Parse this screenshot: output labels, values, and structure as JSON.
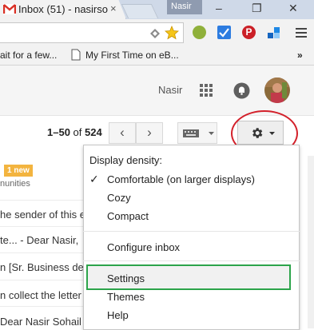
{
  "browser": {
    "tab_title": "Inbox (51) - nasirso",
    "tab_close": "×",
    "user_chip": "Nasir",
    "window_controls": [
      "–",
      "❐",
      "✕"
    ],
    "extensions": [
      "diamond-icon",
      "star-icon",
      "puzzle-icon",
      "check-icon",
      "pinterest-icon",
      "dropbox-icon",
      "menu-icon"
    ],
    "bookmarks": [
      {
        "label": "ait for a few..."
      },
      {
        "label": "My First Time on eB..."
      }
    ],
    "bookmarks_overflow": "»"
  },
  "gmail": {
    "user_name": "Nasir",
    "pager": {
      "range": "1–50",
      "of_label": "of",
      "total": "524"
    },
    "prev_icon": "‹",
    "next_icon": "›",
    "list_rows": [
      {
        "text": "nunities"
      },
      {
        "text": "he sender of this e"
      },
      {
        "text": "te... - Dear Nasir, "
      },
      {
        "text": "n [Sr. Business de"
      },
      {
        "text": "n collect the letter c"
      },
      {
        "text": "Dear Nasir Sohail C"
      }
    ],
    "new_badge": "1 new"
  },
  "menu": {
    "heading": "Display density:",
    "check": "✓",
    "items": {
      "comfortable": "Comfortable (on larger displays)",
      "cozy": "Cozy",
      "compact": "Compact",
      "configure": "Configure inbox",
      "settings": "Settings",
      "themes": "Themes",
      "help": "Help"
    }
  },
  "colors": {
    "highlight_oval": "#d3202a",
    "highlight_box": "#2ca44a",
    "new_badge": "#f3b43f"
  }
}
